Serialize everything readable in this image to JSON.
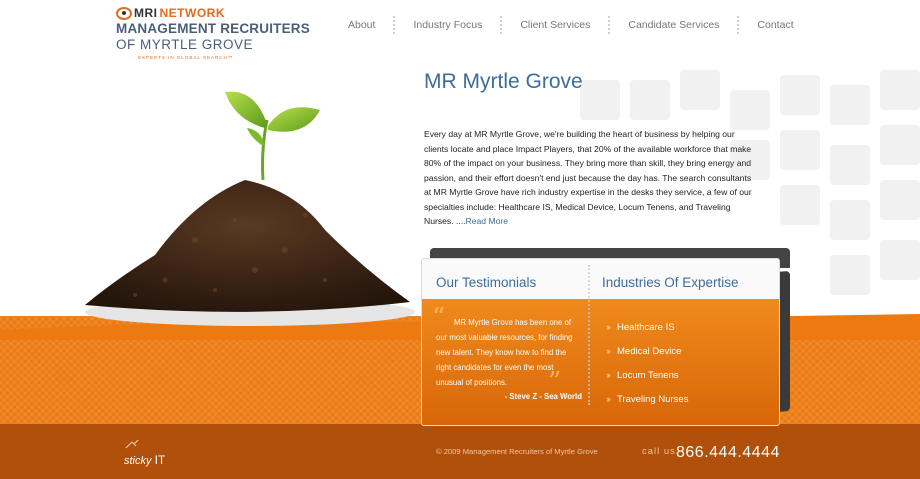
{
  "logo": {
    "brand": "MRI",
    "network": "NETWORK",
    "line1": "MANAGEMENT RECRUITERS",
    "line2": "OF MYRTLE GROVE",
    "tagline": "EXPERTS IN GLOBAL SEARCH™"
  },
  "nav": {
    "items": [
      "About",
      "Industry Focus",
      "Client Services",
      "Candidate Services",
      "Contact"
    ]
  },
  "hero": {
    "title": "MR Myrtle Grove",
    "body": "Every day at MR Myrtle Grove, we're building the heart of business by helping our clients locate and place Impact Players, that 20% of the available workforce that make 80% of the impact on your business. They bring more than skill, they bring energy and passion, and their effort doesn't end just because the day has. The search consultants at MR Myrtle Grove have rich industry expertise in the desks they service, a few of our specialties include:  Healthcare IS, Medical Device, Locum Tenens, and Traveling Nurses. ....",
    "read_more": "Read More"
  },
  "testimonials": {
    "title": "Our Testimonials",
    "quote": "MR Myrtle Grove has been one of our most valuable resources, for finding new talent. They know how to find the right candidates for even the most unusual of positions.",
    "author": "- Steve Z - Sea World"
  },
  "industries": {
    "title": "Industries Of Expertise",
    "items": [
      "Healthcare IS",
      "Medical Device",
      "Locum Tenens",
      "Traveling Nurses"
    ]
  },
  "footer": {
    "credit_word": "sticky",
    "credit_suffix": "IT",
    "copyright": "© 2009 Management Recruiters of Myrtle Grove",
    "call_label": "call us",
    "phone": "866.444.4444"
  },
  "colors": {
    "orange": "#ec7a10",
    "dark_orange": "#b0500b",
    "blue": "#3e6d98"
  }
}
